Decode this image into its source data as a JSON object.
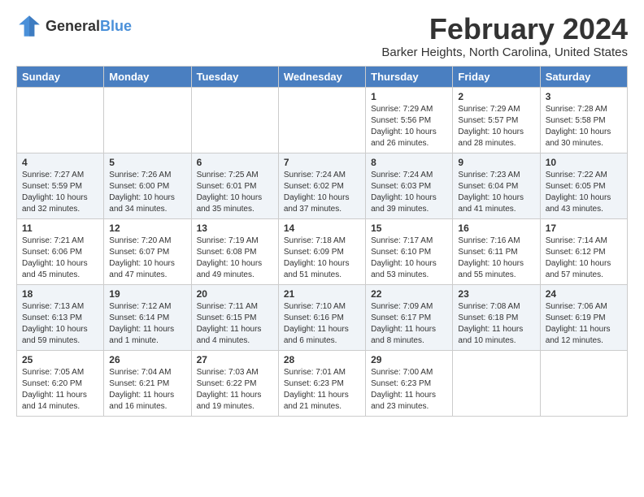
{
  "logo": {
    "text_general": "General",
    "text_blue": "Blue"
  },
  "title": "February 2024",
  "subtitle": "Barker Heights, North Carolina, United States",
  "days_of_week": [
    "Sunday",
    "Monday",
    "Tuesday",
    "Wednesday",
    "Thursday",
    "Friday",
    "Saturday"
  ],
  "weeks": [
    {
      "shaded": false,
      "days": [
        {
          "number": "",
          "info": ""
        },
        {
          "number": "",
          "info": ""
        },
        {
          "number": "",
          "info": ""
        },
        {
          "number": "",
          "info": ""
        },
        {
          "number": "1",
          "info": "Sunrise: 7:29 AM\nSunset: 5:56 PM\nDaylight: 10 hours\nand 26 minutes."
        },
        {
          "number": "2",
          "info": "Sunrise: 7:29 AM\nSunset: 5:57 PM\nDaylight: 10 hours\nand 28 minutes."
        },
        {
          "number": "3",
          "info": "Sunrise: 7:28 AM\nSunset: 5:58 PM\nDaylight: 10 hours\nand 30 minutes."
        }
      ]
    },
    {
      "shaded": true,
      "days": [
        {
          "number": "4",
          "info": "Sunrise: 7:27 AM\nSunset: 5:59 PM\nDaylight: 10 hours\nand 32 minutes."
        },
        {
          "number": "5",
          "info": "Sunrise: 7:26 AM\nSunset: 6:00 PM\nDaylight: 10 hours\nand 34 minutes."
        },
        {
          "number": "6",
          "info": "Sunrise: 7:25 AM\nSunset: 6:01 PM\nDaylight: 10 hours\nand 35 minutes."
        },
        {
          "number": "7",
          "info": "Sunrise: 7:24 AM\nSunset: 6:02 PM\nDaylight: 10 hours\nand 37 minutes."
        },
        {
          "number": "8",
          "info": "Sunrise: 7:24 AM\nSunset: 6:03 PM\nDaylight: 10 hours\nand 39 minutes."
        },
        {
          "number": "9",
          "info": "Sunrise: 7:23 AM\nSunset: 6:04 PM\nDaylight: 10 hours\nand 41 minutes."
        },
        {
          "number": "10",
          "info": "Sunrise: 7:22 AM\nSunset: 6:05 PM\nDaylight: 10 hours\nand 43 minutes."
        }
      ]
    },
    {
      "shaded": false,
      "days": [
        {
          "number": "11",
          "info": "Sunrise: 7:21 AM\nSunset: 6:06 PM\nDaylight: 10 hours\nand 45 minutes."
        },
        {
          "number": "12",
          "info": "Sunrise: 7:20 AM\nSunset: 6:07 PM\nDaylight: 10 hours\nand 47 minutes."
        },
        {
          "number": "13",
          "info": "Sunrise: 7:19 AM\nSunset: 6:08 PM\nDaylight: 10 hours\nand 49 minutes."
        },
        {
          "number": "14",
          "info": "Sunrise: 7:18 AM\nSunset: 6:09 PM\nDaylight: 10 hours\nand 51 minutes."
        },
        {
          "number": "15",
          "info": "Sunrise: 7:17 AM\nSunset: 6:10 PM\nDaylight: 10 hours\nand 53 minutes."
        },
        {
          "number": "16",
          "info": "Sunrise: 7:16 AM\nSunset: 6:11 PM\nDaylight: 10 hours\nand 55 minutes."
        },
        {
          "number": "17",
          "info": "Sunrise: 7:14 AM\nSunset: 6:12 PM\nDaylight: 10 hours\nand 57 minutes."
        }
      ]
    },
    {
      "shaded": true,
      "days": [
        {
          "number": "18",
          "info": "Sunrise: 7:13 AM\nSunset: 6:13 PM\nDaylight: 10 hours\nand 59 minutes."
        },
        {
          "number": "19",
          "info": "Sunrise: 7:12 AM\nSunset: 6:14 PM\nDaylight: 11 hours\nand 1 minute."
        },
        {
          "number": "20",
          "info": "Sunrise: 7:11 AM\nSunset: 6:15 PM\nDaylight: 11 hours\nand 4 minutes."
        },
        {
          "number": "21",
          "info": "Sunrise: 7:10 AM\nSunset: 6:16 PM\nDaylight: 11 hours\nand 6 minutes."
        },
        {
          "number": "22",
          "info": "Sunrise: 7:09 AM\nSunset: 6:17 PM\nDaylight: 11 hours\nand 8 minutes."
        },
        {
          "number": "23",
          "info": "Sunrise: 7:08 AM\nSunset: 6:18 PM\nDaylight: 11 hours\nand 10 minutes."
        },
        {
          "number": "24",
          "info": "Sunrise: 7:06 AM\nSunset: 6:19 PM\nDaylight: 11 hours\nand 12 minutes."
        }
      ]
    },
    {
      "shaded": false,
      "days": [
        {
          "number": "25",
          "info": "Sunrise: 7:05 AM\nSunset: 6:20 PM\nDaylight: 11 hours\nand 14 minutes."
        },
        {
          "number": "26",
          "info": "Sunrise: 7:04 AM\nSunset: 6:21 PM\nDaylight: 11 hours\nand 16 minutes."
        },
        {
          "number": "27",
          "info": "Sunrise: 7:03 AM\nSunset: 6:22 PM\nDaylight: 11 hours\nand 19 minutes."
        },
        {
          "number": "28",
          "info": "Sunrise: 7:01 AM\nSunset: 6:23 PM\nDaylight: 11 hours\nand 21 minutes."
        },
        {
          "number": "29",
          "info": "Sunrise: 7:00 AM\nSunset: 6:23 PM\nDaylight: 11 hours\nand 23 minutes."
        },
        {
          "number": "",
          "info": ""
        },
        {
          "number": "",
          "info": ""
        }
      ]
    }
  ]
}
